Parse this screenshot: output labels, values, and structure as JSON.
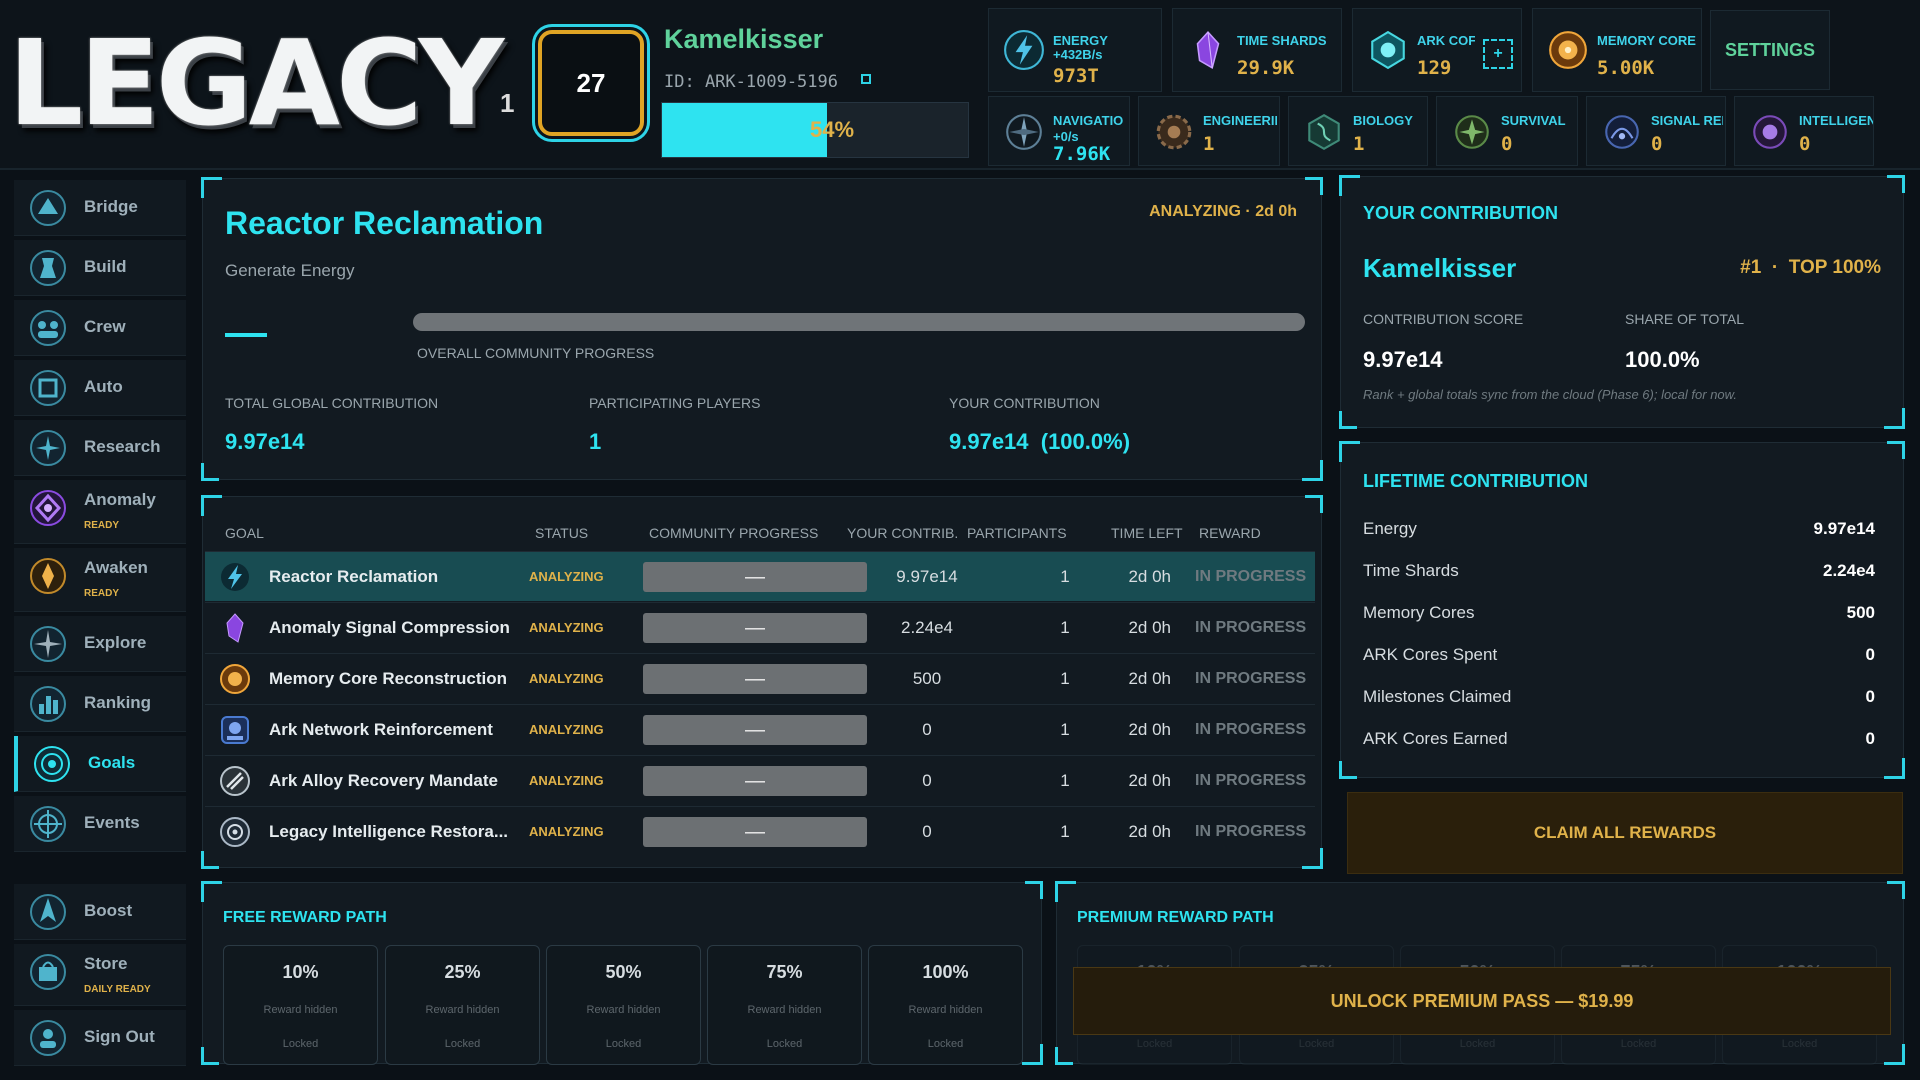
{
  "header": {
    "logo": "LEGACY",
    "logo_sub": "1",
    "level": "27",
    "player_name": "Kamelkisser",
    "player_id": "ID: ARK-1009-5196",
    "xp_percent_label": "54%",
    "xp_fraction": 0.54,
    "settings_label": "SETTINGS"
  },
  "resources_row1": [
    {
      "label": "ENERGY",
      "sub": "+432B/s",
      "value": "973T",
      "icon": "energy-icon",
      "color": "#4fc3e8"
    },
    {
      "label": "TIME SHARDS",
      "sub": "",
      "value": "29.9K",
      "icon": "time-shard-icon",
      "color": "#a660f0"
    },
    {
      "label": "ARK COF",
      "sub": "",
      "value": "129",
      "icon": "ark-core-icon",
      "color": "#47d7e0"
    },
    {
      "label": "MEMORY CORE",
      "sub": "",
      "value": "5.00K",
      "icon": "memory-core-icon",
      "color": "#e59a2a"
    }
  ],
  "resources_row2": [
    {
      "label": "NAVIGATIO",
      "sub": "+0/s",
      "value": "7.96K",
      "icon": "navigation-icon"
    },
    {
      "label": "ENGINEERII",
      "value": "1",
      "icon": "engineering-icon"
    },
    {
      "label": "BIOLOGY",
      "value": "1",
      "icon": "biology-icon"
    },
    {
      "label": "SURVIVAL",
      "value": "0",
      "icon": "survival-icon"
    },
    {
      "label": "SIGNAL REI",
      "value": "0",
      "icon": "signal-icon"
    },
    {
      "label": "INTELLIGEN",
      "value": "0",
      "icon": "intelligence-icon"
    }
  ],
  "sidebar": {
    "items": [
      {
        "label": "Bridge",
        "badge": "",
        "icon": "bridge-icon"
      },
      {
        "label": "Build",
        "badge": "",
        "icon": "build-icon"
      },
      {
        "label": "Crew",
        "badge": "",
        "icon": "crew-icon"
      },
      {
        "label": "Auto",
        "badge": "",
        "icon": "auto-icon"
      },
      {
        "label": "Research",
        "badge": "",
        "icon": "research-icon"
      },
      {
        "label": "Anomaly",
        "badge": "READY",
        "icon": "anomaly-icon"
      },
      {
        "label": "Awaken",
        "badge": "READY",
        "icon": "awaken-icon"
      },
      {
        "label": "Explore",
        "badge": "",
        "icon": "explore-icon"
      },
      {
        "label": "Ranking",
        "badge": "",
        "icon": "ranking-icon"
      },
      {
        "label": "Goals",
        "badge": "",
        "icon": "goals-icon",
        "active": true
      },
      {
        "label": "Events",
        "badge": "",
        "icon": "events-icon"
      },
      {
        "label": "Boost",
        "badge": "",
        "icon": "boost-icon"
      },
      {
        "label": "Store",
        "badge": "DAILY READY",
        "icon": "store-icon"
      },
      {
        "label": "Sign Out",
        "badge": "",
        "icon": "sign-out-icon"
      }
    ]
  },
  "goal": {
    "title": "Reactor Reclamation",
    "subtitle": "Generate Energy",
    "status": "ANALYZING · 2d 0h",
    "progress_label": "OVERALL COMMUNITY PROGRESS",
    "stats": [
      {
        "label": "TOTAL GLOBAL CONTRIBUTION",
        "value": "9.97e14"
      },
      {
        "label": "PARTICIPATING PLAYERS",
        "value": "1"
      },
      {
        "label": "YOUR CONTRIBUTION",
        "value": "9.97e14  (100.0%)"
      }
    ]
  },
  "table": {
    "headers": [
      "GOAL",
      "STATUS",
      "COMMUNITY PROGRESS",
      "YOUR CONTRIB.",
      "PARTICIPANTS",
      "TIME LEFT",
      "REWARD"
    ],
    "rows": [
      {
        "name": "Reactor Reclamation",
        "status": "ANALYZING",
        "progress": "—",
        "contrib": "9.97e14",
        "participants": "1",
        "time": "2d 0h",
        "reward": "IN PROGRESS",
        "icon": "energy-icon"
      },
      {
        "name": "Anomaly Signal Compression",
        "status": "ANALYZING",
        "progress": "—",
        "contrib": "2.24e4",
        "participants": "1",
        "time": "2d 0h",
        "reward": "IN PROGRESS",
        "icon": "time-shard-icon"
      },
      {
        "name": "Memory Core Reconstruction",
        "status": "ANALYZING",
        "progress": "—",
        "contrib": "500",
        "participants": "1",
        "time": "2d 0h",
        "reward": "IN PROGRESS",
        "icon": "memory-core-icon"
      },
      {
        "name": "Ark Network Reinforcement",
        "status": "ANALYZING",
        "progress": "—",
        "contrib": "0",
        "participants": "1",
        "time": "2d 0h",
        "reward": "IN PROGRESS",
        "icon": "ark-network-icon"
      },
      {
        "name": "Ark Alloy Recovery Mandate",
        "status": "ANALYZING",
        "progress": "—",
        "contrib": "0",
        "participants": "1",
        "time": "2d 0h",
        "reward": "IN PROGRESS",
        "icon": "alloy-icon"
      },
      {
        "name": "Legacy Intelligence Restora...",
        "status": "ANALYZING",
        "progress": "—",
        "contrib": "0",
        "participants": "1",
        "time": "2d 0h",
        "reward": "IN PROGRESS",
        "icon": "intelligence-icon"
      }
    ]
  },
  "your_contribution": {
    "title": "YOUR CONTRIBUTION",
    "name": "Kamelkisser",
    "rank": "#1  ·  TOP 100%",
    "score_label": "CONTRIBUTION SCORE",
    "score_value": "9.97e14",
    "share_label": "SHARE OF TOTAL",
    "share_value": "100.0%",
    "note": "Rank + global totals sync from the cloud (Phase 6); local for now."
  },
  "lifetime": {
    "title": "LIFETIME CONTRIBUTION",
    "rows": [
      {
        "label": "Energy",
        "value": "9.97e14"
      },
      {
        "label": "Time Shards",
        "value": "2.24e4"
      },
      {
        "label": "Memory Cores",
        "value": "500"
      },
      {
        "label": "ARK Cores Spent",
        "value": "0"
      },
      {
        "label": "Milestones Claimed",
        "value": "0"
      },
      {
        "label": "ARK Cores Earned",
        "value": "0"
      }
    ]
  },
  "claim_label": "CLAIM ALL REWARDS",
  "free_path": {
    "title": "FREE REWARD PATH",
    "tiers": [
      {
        "pct": "10%",
        "hidden": "Reward hidden",
        "state": "Locked"
      },
      {
        "pct": "25%",
        "hidden": "Reward hidden",
        "state": "Locked"
      },
      {
        "pct": "50%",
        "hidden": "Reward hidden",
        "state": "Locked"
      },
      {
        "pct": "75%",
        "hidden": "Reward hidden",
        "state": "Locked"
      },
      {
        "pct": "100%",
        "hidden": "Reward hidden",
        "state": "Locked"
      }
    ]
  },
  "premium_path": {
    "title": "PREMIUM REWARD PATH",
    "unlock_label": "UNLOCK PREMIUM PASS — $19.99",
    "tiers": [
      {
        "pct": "10%",
        "state": "Locked"
      },
      {
        "pct": "25%",
        "state": "Locked"
      },
      {
        "pct": "50%",
        "state": "Locked"
      },
      {
        "pct": "75%",
        "state": "Locked"
      },
      {
        "pct": "100%",
        "state": "Locked"
      }
    ]
  },
  "colors": {
    "accent": "#2ee3f0",
    "gold": "#e0b24a",
    "green": "#5fd29b"
  }
}
